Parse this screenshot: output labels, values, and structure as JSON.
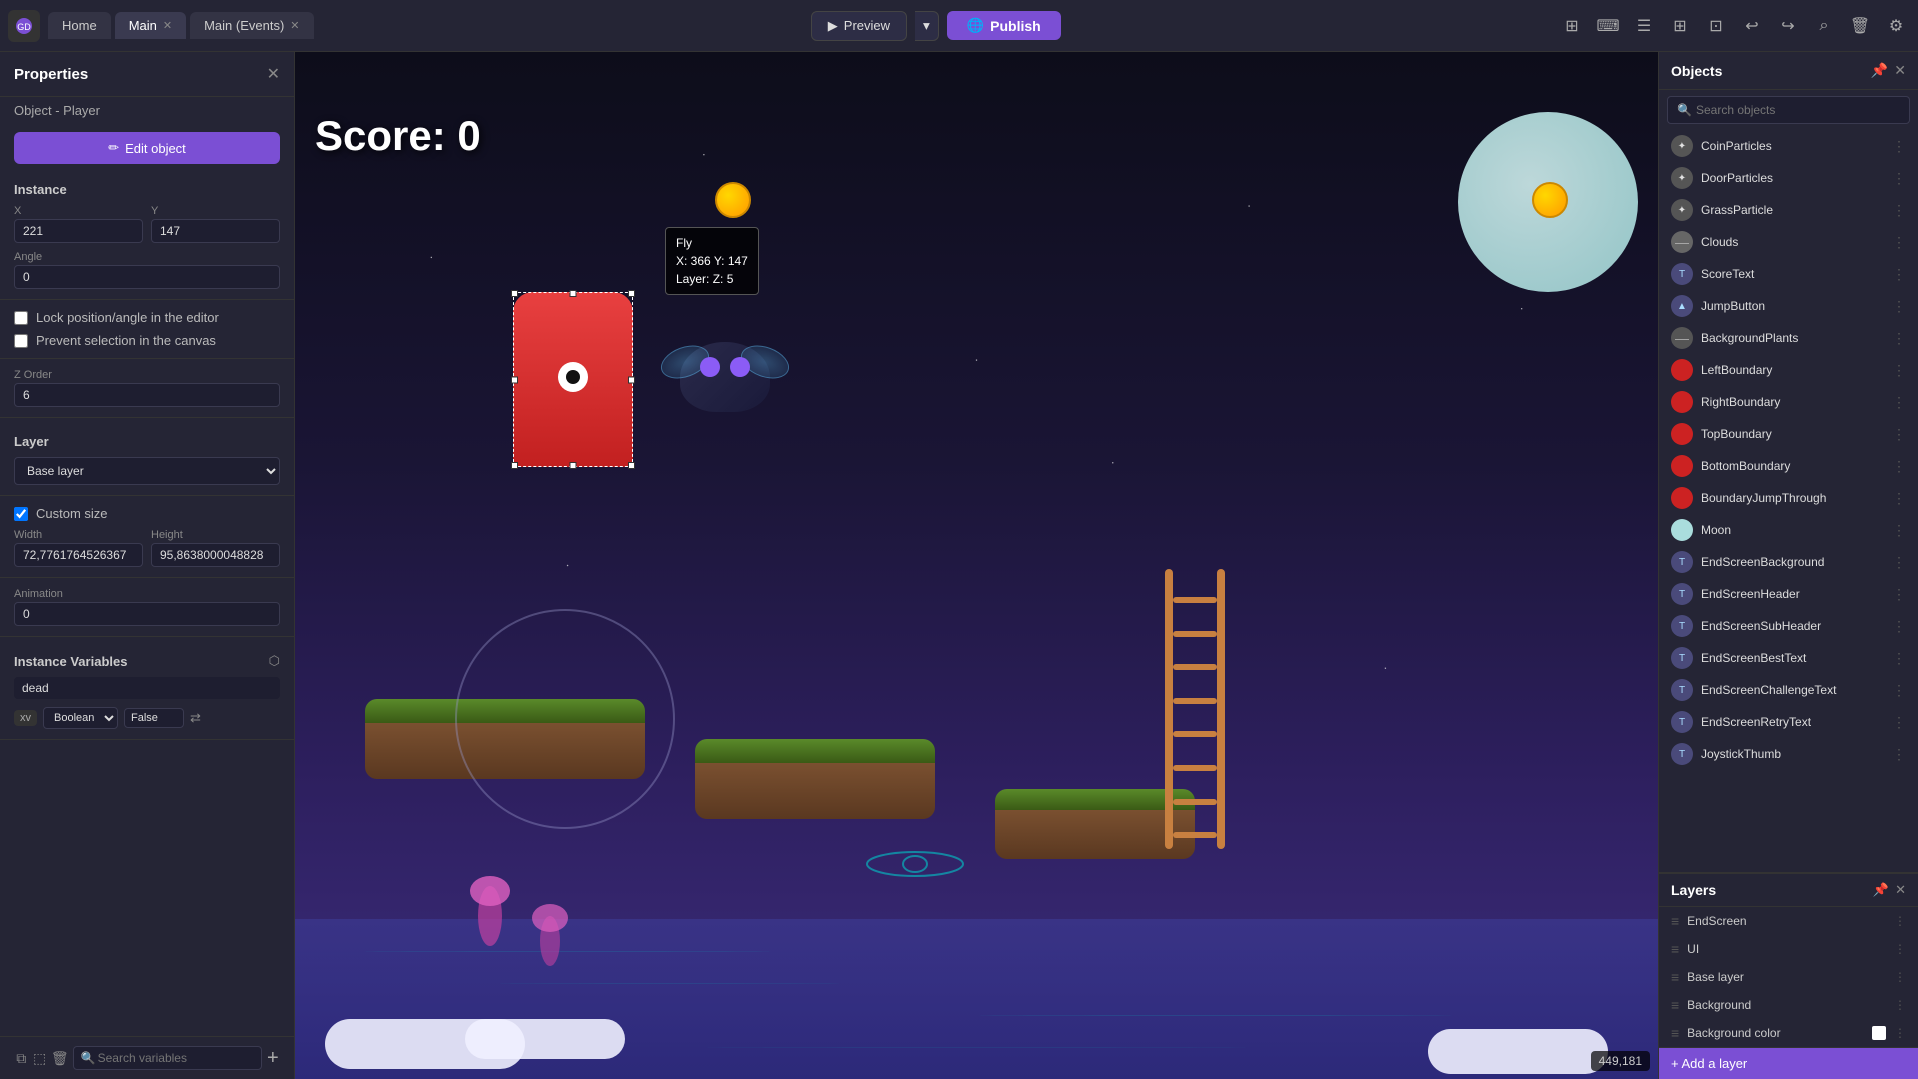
{
  "app": {
    "logo": "GD",
    "tabs": [
      {
        "label": "Home",
        "closable": false
      },
      {
        "label": "Main",
        "closable": true,
        "active": true
      },
      {
        "label": "Main (Events)",
        "closable": true
      }
    ]
  },
  "topbar": {
    "preview_label": "Preview",
    "publish_label": "Publish",
    "icons": [
      "layers-icon",
      "code-icon",
      "list-icon",
      "grid-icon",
      "ruler-icon",
      "undo-icon",
      "redo-icon",
      "zoom-icon",
      "trash-icon",
      "settings-icon"
    ]
  },
  "left_panel": {
    "title": "Properties",
    "object_prefix": "Object",
    "object_name": "- Player",
    "edit_btn_label": "Edit object",
    "instance_section": "Instance",
    "x_label": "X",
    "x_value": "221",
    "y_label": "Y",
    "y_value": "147",
    "angle_label": "Angle",
    "angle_value": "0",
    "lock_label": "Lock position/angle in the editor",
    "prevent_label": "Prevent selection in the canvas",
    "z_order_label": "Z Order",
    "z_order_value": "6",
    "layer_label": "Layer",
    "layer_value": "Base layer",
    "custom_size_label": "Custom size",
    "width_label": "Width",
    "width_value": "72,7761764526367",
    "height_label": "Height",
    "height_value": "95,8638000048828",
    "animation_label": "Animation",
    "animation_value": "0",
    "instance_vars_title": "Instance Variables",
    "var_name": "dead",
    "var_tag": "xv",
    "var_type": "Boolean",
    "var_value": "False",
    "search_vars_placeholder": "Search variables"
  },
  "canvas": {
    "score_text": "Score: 0",
    "fly_tooltip": {
      "name": "Fly",
      "x": "X: 366",
      "y": "Y: 147",
      "layer": "Layer:",
      "z": "Z: 5"
    },
    "coords": "449,181"
  },
  "right_panel": {
    "objects_title": "Objects",
    "pin_icon": "pin-icon",
    "close_icon": "close-icon",
    "objects": [
      {
        "name": "CoinParticles",
        "icon_bg": "#555",
        "icon_char": "✦"
      },
      {
        "name": "DoorParticles",
        "icon_bg": "#555",
        "icon_char": "✦"
      },
      {
        "name": "GrassParticle",
        "icon_bg": "#555",
        "icon_char": "✦"
      },
      {
        "name": "Clouds",
        "icon_bg": "#666",
        "icon_char": "—"
      },
      {
        "name": "ScoreText",
        "icon_bg": "#4a4a7a",
        "icon_char": "T"
      },
      {
        "name": "JumpButton",
        "icon_bg": "#4a4a7a",
        "icon_char": "▲"
      },
      {
        "name": "BackgroundPlants",
        "icon_bg": "#555",
        "icon_char": "—"
      },
      {
        "name": "LeftBoundary",
        "icon_bg": "#cc2222",
        "icon_char": ""
      },
      {
        "name": "RightBoundary",
        "icon_bg": "#cc2222",
        "icon_char": ""
      },
      {
        "name": "TopBoundary",
        "icon_bg": "#cc2222",
        "icon_char": ""
      },
      {
        "name": "BottomBoundary",
        "icon_bg": "#cc2222",
        "icon_char": ""
      },
      {
        "name": "BoundaryJumpThrough",
        "icon_bg": "#cc2222",
        "icon_char": ""
      },
      {
        "name": "Moon",
        "icon_bg": "#aadddd",
        "icon_char": ""
      },
      {
        "name": "EndScreenBackground",
        "icon_bg": "#4a4a7a",
        "icon_char": "T"
      },
      {
        "name": "EndScreenHeader",
        "icon_bg": "#4a4a7a",
        "icon_char": "T"
      },
      {
        "name": "EndScreenSubHeader",
        "icon_bg": "#4a4a7a",
        "icon_char": "T"
      },
      {
        "name": "EndScreenBestText",
        "icon_bg": "#4a4a7a",
        "icon_char": "T"
      },
      {
        "name": "EndScreenChallengeText",
        "icon_bg": "#4a4a7a",
        "icon_char": "T"
      },
      {
        "name": "EndScreenRetryText",
        "icon_bg": "#4a4a7a",
        "icon_char": "T"
      },
      {
        "name": "JoystickThumb",
        "icon_bg": "#4a4a7a",
        "icon_char": "T"
      }
    ],
    "search_objects_placeholder": "Search objects",
    "layers_title": "Layers",
    "layers": [
      {
        "name": "EndScreen",
        "color": null
      },
      {
        "name": "UI",
        "color": null
      },
      {
        "name": "Base layer",
        "color": null
      },
      {
        "name": "Background",
        "color": null
      },
      {
        "name": "Background color",
        "color": "#fff",
        "has_swatch": true
      }
    ],
    "add_layer_label": "+ Add a layer"
  }
}
